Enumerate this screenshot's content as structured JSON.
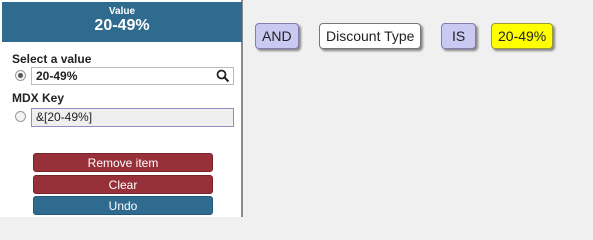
{
  "panel": {
    "header_small": "Value",
    "header_big": "20-49%",
    "select_label": "Select a value",
    "selected_value": "20-49%",
    "mdx_label": "MDX Key",
    "mdx_value": "&[20-49%]",
    "buttons": {
      "remove": "Remove item",
      "clear": "Clear",
      "undo": "Undo"
    }
  },
  "expression": {
    "chips": [
      {
        "type": "operator",
        "label": "AND"
      },
      {
        "type": "field",
        "label": "Discount Type"
      },
      {
        "type": "operator",
        "label": "IS"
      },
      {
        "type": "value",
        "label": "20-49%"
      }
    ]
  },
  "colors": {
    "header_bg": "#2f6a8f",
    "button_red": "#98303a",
    "button_blue": "#2f6a8f",
    "operator_chip": "#c9c9f1",
    "value_chip": "#ffff00"
  }
}
